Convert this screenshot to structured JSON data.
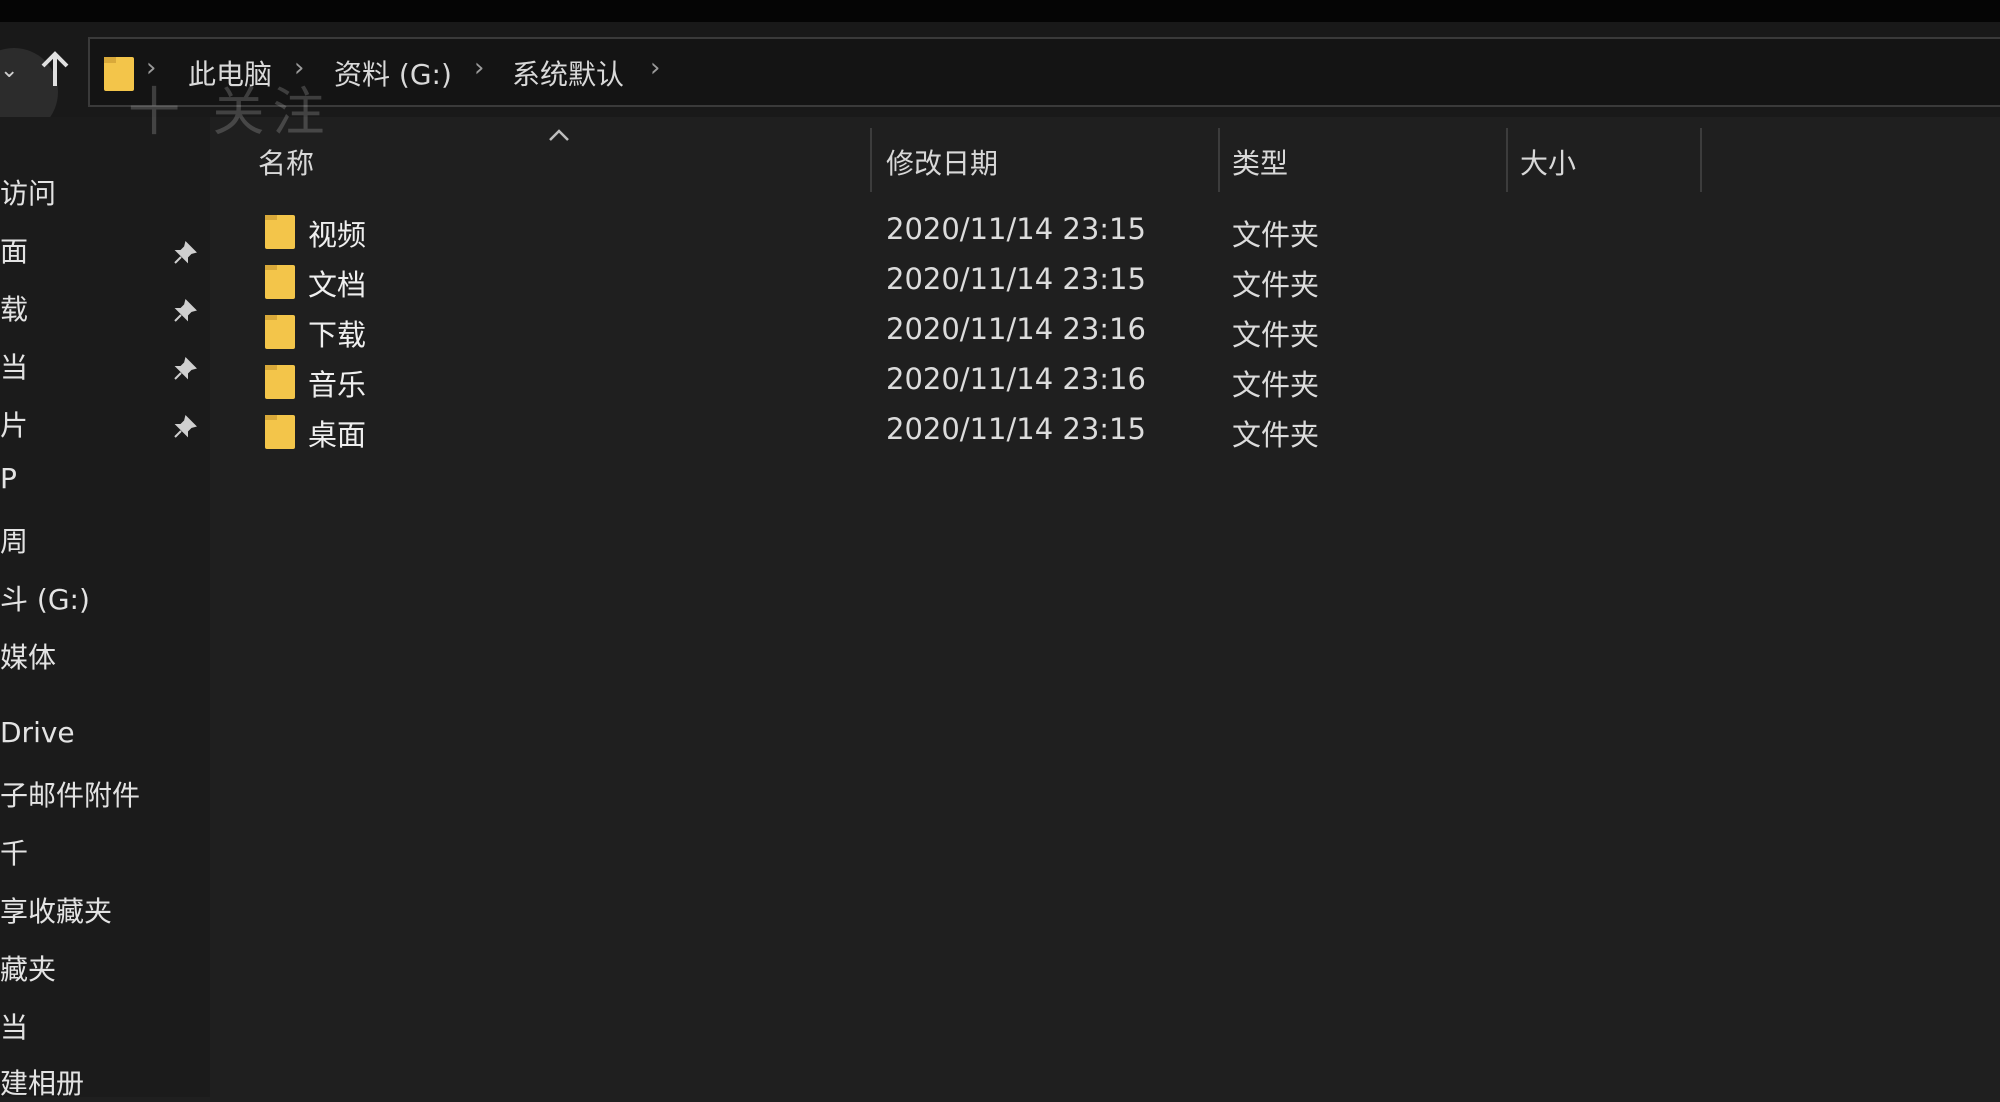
{
  "breadcrumb": {
    "items": [
      "此电脑",
      "资料 (G:)",
      "系统默认"
    ]
  },
  "watermark": "十 关注",
  "sidebar": {
    "items": [
      {
        "label": "访问",
        "pinned": false
      },
      {
        "label": "面",
        "pinned": true
      },
      {
        "label": "载",
        "pinned": true
      },
      {
        "label": "当",
        "pinned": true
      },
      {
        "label": "片",
        "pinned": true
      },
      {
        "label": "P",
        "pinned": false
      },
      {
        "label": "周",
        "pinned": false
      },
      {
        "label": "斗 (G:)",
        "pinned": false
      },
      {
        "label": "媒体",
        "pinned": false
      },
      {
        "label": "Drive",
        "pinned": false
      },
      {
        "label": "子邮件附件",
        "pinned": false
      },
      {
        "label": "千",
        "pinned": false
      },
      {
        "label": "享收藏夹",
        "pinned": false
      },
      {
        "label": "藏夹",
        "pinned": false
      },
      {
        "label": "当",
        "pinned": false
      },
      {
        "label": "建相册",
        "pinned": false
      }
    ]
  },
  "columns": {
    "name": "名称",
    "modified": "修改日期",
    "type": "类型",
    "size": "大小"
  },
  "files": [
    {
      "name": "视频",
      "modified": "2020/11/14 23:15",
      "type": "文件夹"
    },
    {
      "name": "文档",
      "modified": "2020/11/14 23:15",
      "type": "文件夹"
    },
    {
      "name": "下载",
      "modified": "2020/11/14 23:16",
      "type": "文件夹"
    },
    {
      "name": "音乐",
      "modified": "2020/11/14 23:16",
      "type": "文件夹"
    },
    {
      "name": "桌面",
      "modified": "2020/11/14 23:15",
      "type": "文件夹"
    }
  ],
  "colors": {
    "folder": "#f3c54a",
    "background": "#1f1f1f"
  }
}
